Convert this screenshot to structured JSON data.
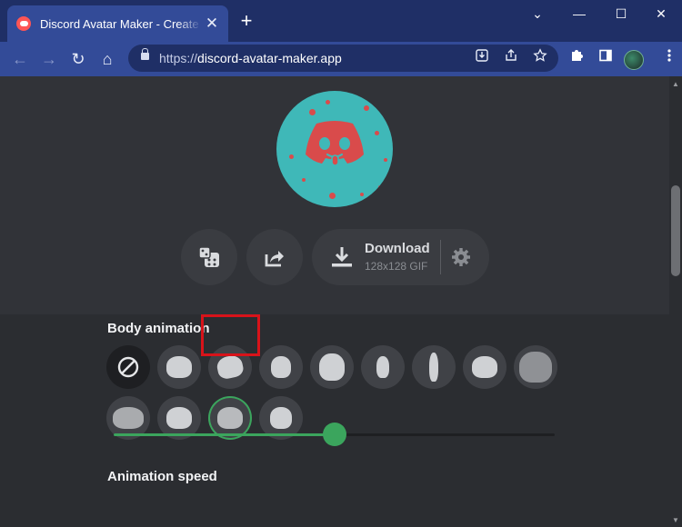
{
  "browser": {
    "tab_title": "Discord Avatar Maker - Create yo",
    "tab_close": "✕",
    "new_tab": "+",
    "window_controls": {
      "minimize": "—",
      "maximize": "☐",
      "close": "✕",
      "menu": "⌄"
    },
    "url_scheme": "https://",
    "url_host": "discord-avatar-maker.app",
    "nav": {
      "back": "←",
      "forward": "→",
      "reload": "↻",
      "home": "⌂"
    }
  },
  "preview": {
    "colors": {
      "background": "#3fb8b8",
      "face": "#d94b4b"
    }
  },
  "actions": {
    "randomize_icon": "dice-icon",
    "share_icon": "share-icon",
    "download_label": "Download",
    "download_sub": "128x128 GIF",
    "settings_icon": "gear-icon"
  },
  "body_animation": {
    "title": "Body animation",
    "options_count": 13,
    "selected_index": 11
  },
  "animation_speed": {
    "title": "Animation speed",
    "value_fraction": 0.5
  },
  "colors": {
    "accent": "#3ba55d",
    "highlight": "#d8131a"
  }
}
